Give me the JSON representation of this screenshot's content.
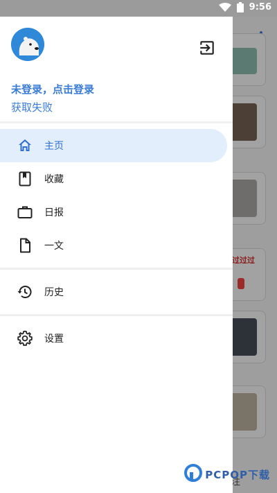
{
  "status_bar": {
    "time": "9:56",
    "icons": [
      "wifi-icon",
      "battery-icon"
    ]
  },
  "drawer": {
    "avatar_icon": "polar-bear-avatar",
    "login_prompt": "未登录，点击登录",
    "fetch_status": "获取失败",
    "nav": [
      {
        "label": "主页",
        "icon": "home-icon",
        "active": true
      },
      {
        "label": "收藏",
        "icon": "bookmark-icon",
        "active": false
      },
      {
        "label": "日报",
        "icon": "briefcase-icon",
        "active": false
      },
      {
        "label": "一文",
        "icon": "document-icon",
        "active": false
      },
      {
        "label": "历史",
        "icon": "history-icon",
        "active": false
      },
      {
        "label": "设置",
        "icon": "gear-icon",
        "active": false
      }
    ]
  },
  "background": {
    "card_text": "过过过",
    "bottom_label": "注"
  },
  "watermark": {
    "text": "PCPOP下载"
  },
  "colors": {
    "accent": "#3a7cd5",
    "active_bg": "#e3eefc",
    "scrim": "#9e9e9e"
  }
}
